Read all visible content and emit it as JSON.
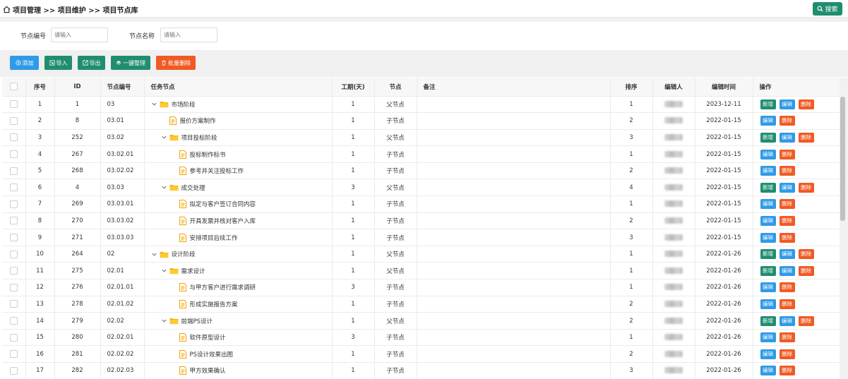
{
  "breadcrumb": "项目管理 >> 项目维护 >> 项目节点库",
  "search_button": "搜索",
  "filters": {
    "node_code_label": "节点编号",
    "node_code_placeholder": "请输入",
    "node_name_label": "节点名称",
    "node_name_placeholder": "请输入"
  },
  "actions": {
    "add": "添加",
    "import": "导入",
    "export": "导出",
    "arrange": "一键整理",
    "batch_delete": "批量删除"
  },
  "columns": {
    "seq": "序号",
    "id": "ID",
    "code": "节点编号",
    "task": "任务节点",
    "days": "工期(天)",
    "node": "节点",
    "remark": "备注",
    "sort": "排序",
    "editor": "编辑人",
    "edit_time": "编辑时间",
    "ops": "操作"
  },
  "op_labels": {
    "new": "新增",
    "edit": "编辑",
    "delete": "删除"
  },
  "colors": {
    "green": "#1f8e6f",
    "blue": "#2f9ae8",
    "orange": "#f05a23",
    "folder": "#f7b500"
  },
  "rows": [
    {
      "seq": "1",
      "id": "1",
      "code": "03",
      "task": "市场阶段",
      "level": 0,
      "parent": true,
      "days": "1",
      "node": "父节点",
      "sort": "1",
      "time": "2023-12-11",
      "ops": [
        "new",
        "edit",
        "delete"
      ]
    },
    {
      "seq": "2",
      "id": "8",
      "code": "03.01",
      "task": "报价方案制作",
      "level": 1,
      "parent": false,
      "days": "1",
      "node": "子节点",
      "sort": "2",
      "time": "2022-01-15",
      "ops": [
        "edit",
        "delete"
      ]
    },
    {
      "seq": "3",
      "id": "252",
      "code": "03.02",
      "task": "项目投标阶段",
      "level": 1,
      "parent": true,
      "days": "1",
      "node": "父节点",
      "sort": "3",
      "time": "2022-01-15",
      "ops": [
        "new",
        "edit",
        "delete"
      ]
    },
    {
      "seq": "4",
      "id": "267",
      "code": "03.02.01",
      "task": "投标制作标书",
      "level": 2,
      "parent": false,
      "days": "1",
      "node": "子节点",
      "sort": "1",
      "time": "2022-01-15",
      "ops": [
        "edit",
        "delete"
      ]
    },
    {
      "seq": "5",
      "id": "268",
      "code": "03.02.02",
      "task": "参考并关注投标工作",
      "level": 2,
      "parent": false,
      "days": "1",
      "node": "子节点",
      "sort": "2",
      "time": "2022-01-15",
      "ops": [
        "edit",
        "delete"
      ]
    },
    {
      "seq": "6",
      "id": "4",
      "code": "03.03",
      "task": "成交处理",
      "level": 1,
      "parent": true,
      "days": "3",
      "node": "父节点",
      "sort": "4",
      "time": "2022-01-15",
      "ops": [
        "new",
        "edit",
        "delete"
      ]
    },
    {
      "seq": "7",
      "id": "269",
      "code": "03.03.01",
      "task": "拟定与客户签订合同内容",
      "level": 2,
      "parent": false,
      "days": "1",
      "node": "子节点",
      "sort": "1",
      "time": "2022-01-15",
      "ops": [
        "edit",
        "delete"
      ]
    },
    {
      "seq": "8",
      "id": "270",
      "code": "03.03.02",
      "task": "开具发票并核对客户入库",
      "level": 2,
      "parent": false,
      "days": "1",
      "node": "子节点",
      "sort": "2",
      "time": "2022-01-15",
      "ops": [
        "edit",
        "delete"
      ]
    },
    {
      "seq": "9",
      "id": "271",
      "code": "03.03.03",
      "task": "安排项目后续工作",
      "level": 2,
      "parent": false,
      "days": "1",
      "node": "子节点",
      "sort": "3",
      "time": "2022-01-15",
      "ops": [
        "edit",
        "delete"
      ]
    },
    {
      "seq": "10",
      "id": "264",
      "code": "02",
      "task": "设计阶段",
      "level": 0,
      "parent": true,
      "days": "1",
      "node": "父节点",
      "sort": "1",
      "time": "2022-01-26",
      "ops": [
        "new",
        "edit",
        "delete"
      ]
    },
    {
      "seq": "11",
      "id": "275",
      "code": "02.01",
      "task": "需求设计",
      "level": 1,
      "parent": true,
      "days": "1",
      "node": "父节点",
      "sort": "1",
      "time": "2022-01-26",
      "ops": [
        "new",
        "edit",
        "delete"
      ]
    },
    {
      "seq": "12",
      "id": "276",
      "code": "02.01.01",
      "task": "与甲方客户进行需求调研",
      "level": 2,
      "parent": false,
      "days": "3",
      "node": "子节点",
      "sort": "1",
      "time": "2022-01-26",
      "ops": [
        "edit",
        "delete"
      ]
    },
    {
      "seq": "13",
      "id": "278",
      "code": "02.01.02",
      "task": "形成实施报告方案",
      "level": 2,
      "parent": false,
      "days": "1",
      "node": "子节点",
      "sort": "2",
      "time": "2022-01-26",
      "ops": [
        "edit",
        "delete"
      ]
    },
    {
      "seq": "14",
      "id": "279",
      "code": "02.02",
      "task": "前端PS设计",
      "level": 1,
      "parent": true,
      "days": "1",
      "node": "父节点",
      "sort": "2",
      "time": "2022-01-26",
      "ops": [
        "new",
        "edit",
        "delete"
      ]
    },
    {
      "seq": "15",
      "id": "280",
      "code": "02.02.01",
      "task": "软件原型设计",
      "level": 2,
      "parent": false,
      "days": "3",
      "node": "子节点",
      "sort": "1",
      "time": "2022-01-26",
      "ops": [
        "edit",
        "delete"
      ]
    },
    {
      "seq": "16",
      "id": "281",
      "code": "02.02.02",
      "task": "PS设计效果出图",
      "level": 2,
      "parent": false,
      "days": "1",
      "node": "子节点",
      "sort": "2",
      "time": "2022-01-26",
      "ops": [
        "edit",
        "delete"
      ]
    },
    {
      "seq": "17",
      "id": "282",
      "code": "02.02.03",
      "task": "甲方效果确认",
      "level": 2,
      "parent": false,
      "days": "1",
      "node": "子节点",
      "sort": "3",
      "time": "2022-01-26",
      "ops": [
        "edit",
        "delete"
      ]
    }
  ]
}
